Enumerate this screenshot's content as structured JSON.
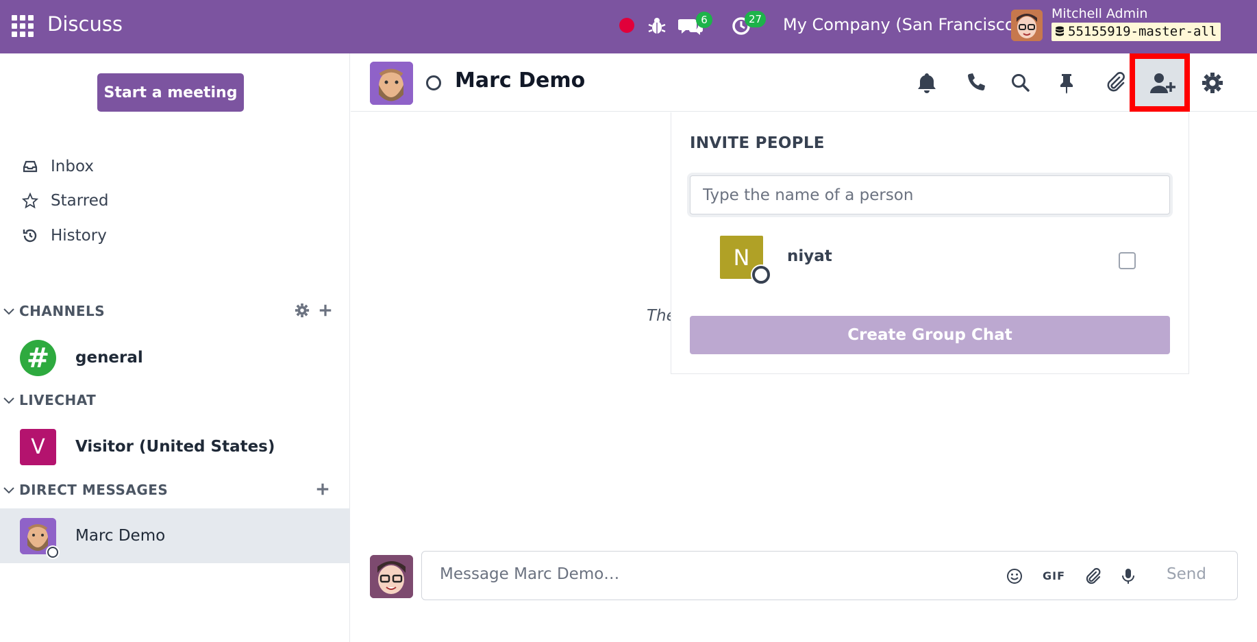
{
  "navbar": {
    "app_title": "Discuss",
    "messages_badge": "6",
    "activities_badge": "27",
    "company": "My Company (San Francisco)",
    "user_name": "Mitchell Admin",
    "db_name": "55155919-master-all",
    "accent_color": "#7c54a0"
  },
  "sidebar": {
    "start_meeting": "Start a meeting",
    "nav": [
      {
        "label": "Inbox",
        "icon": "inbox-icon"
      },
      {
        "label": "Starred",
        "icon": "star-icon"
      },
      {
        "label": "History",
        "icon": "history-icon"
      }
    ],
    "categories": {
      "channels": "CHANNELS",
      "livechat": "LIVECHAT",
      "direct": "DIRECT MESSAGES"
    },
    "channels": [
      {
        "name": "general",
        "avatar": "#"
      }
    ],
    "livechat": [
      {
        "name": "Visitor (United States)",
        "avatar": "V"
      }
    ],
    "direct": [
      {
        "name": "Marc Demo"
      }
    ]
  },
  "thread": {
    "name": "Marc Demo",
    "hint": "The"
  },
  "invite": {
    "title": "INVITE PEOPLE",
    "placeholder": "Type the name of a person",
    "people": [
      {
        "name": "niyat",
        "initial": "N"
      }
    ],
    "create_button": "Create Group Chat"
  },
  "composer": {
    "placeholder": "Message Marc Demo…",
    "gif_label": "GIF",
    "send_label": "Send"
  }
}
